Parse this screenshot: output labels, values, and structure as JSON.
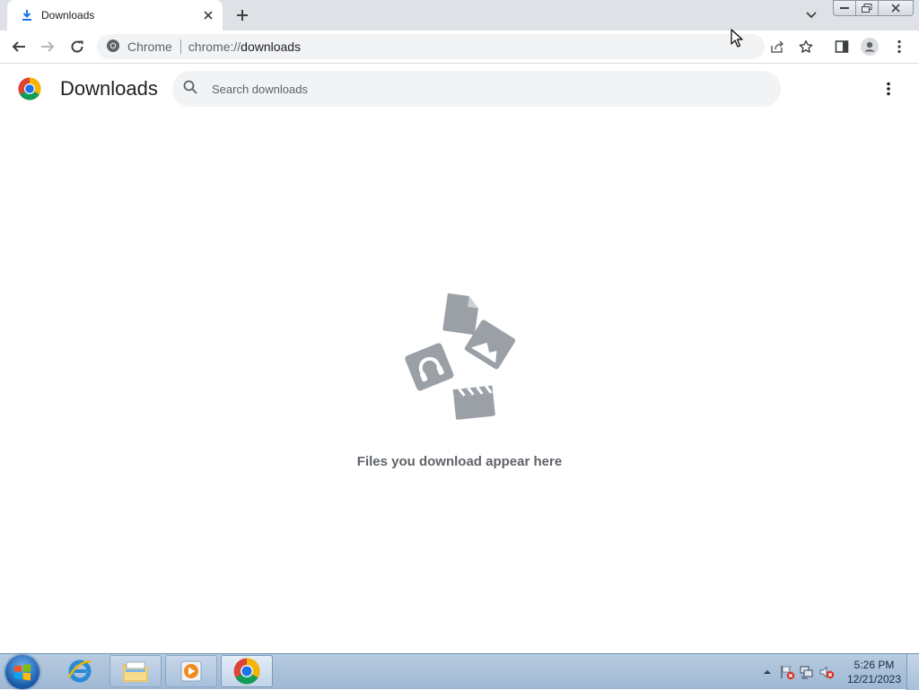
{
  "tab": {
    "title": "Downloads",
    "icon": "download-icon"
  },
  "omnibox": {
    "site_label": "Chrome",
    "url_scheme": "chrome://",
    "url_host": "downloads"
  },
  "page": {
    "title": "Downloads",
    "search_placeholder": "Search downloads",
    "empty_message": "Files you download appear here"
  },
  "taskbar": {
    "pinned": [
      "internet-explorer-icon",
      "file-explorer-icon",
      "media-player-icon",
      "chrome-icon"
    ],
    "active": "chrome-icon"
  },
  "clock": {
    "time": "5:26 PM",
    "date": "12/21/2023"
  },
  "colors": {
    "accent": "#1a73e8",
    "empty_art": "#9aa0a6",
    "tab_strip": "#dee1e6"
  }
}
